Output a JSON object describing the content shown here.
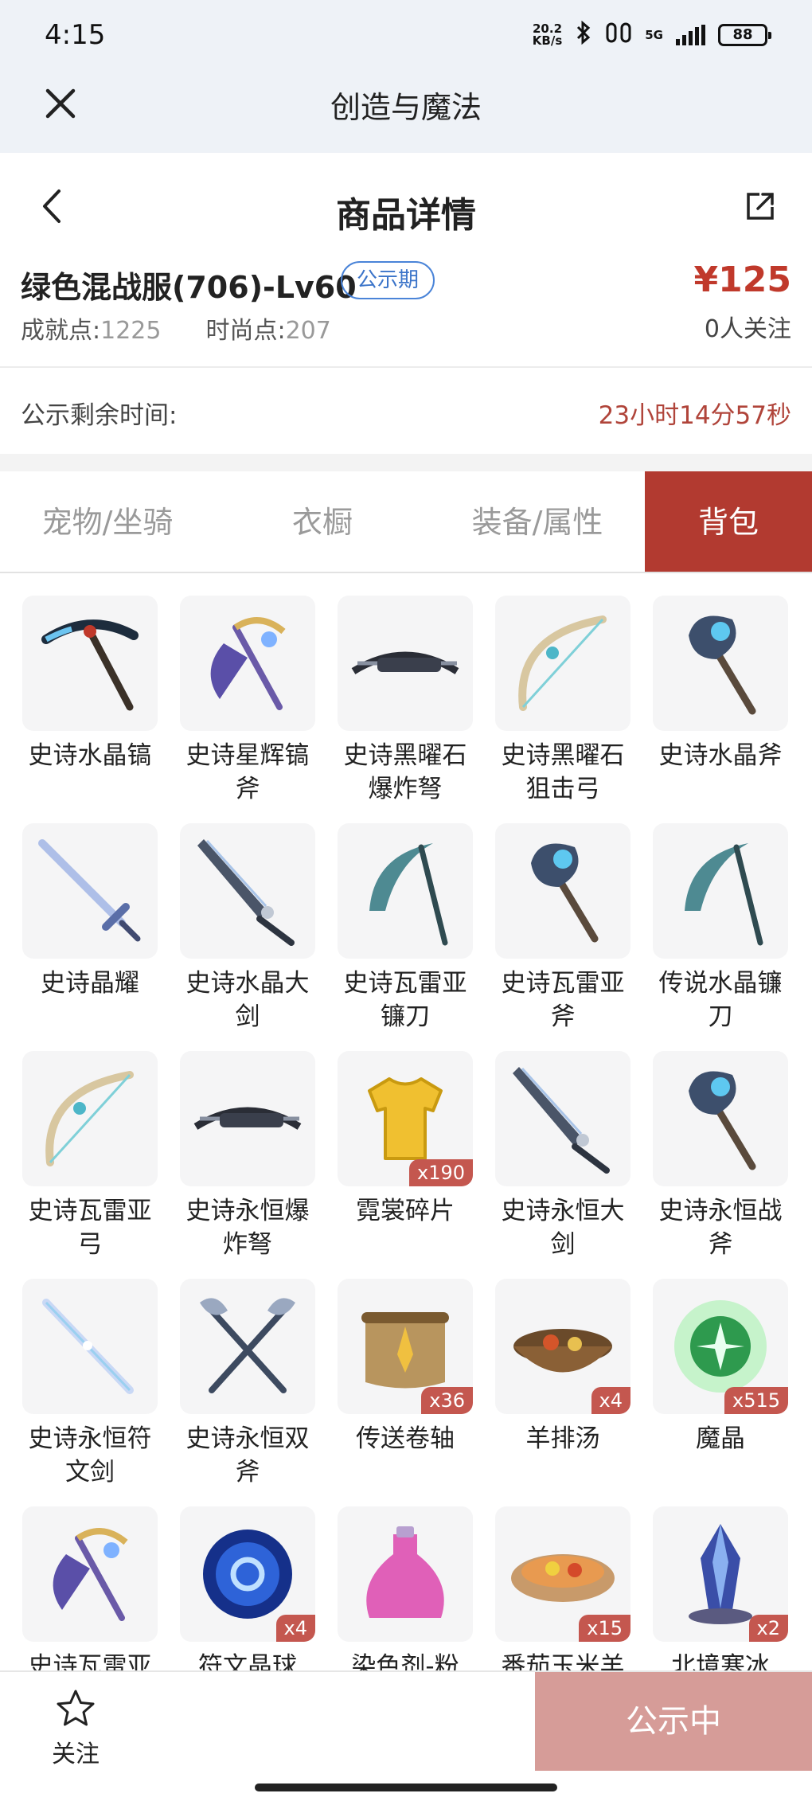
{
  "status_bar": {
    "time": "4:15",
    "net_speed_value": "20.2",
    "net_speed_unit": "KB/s",
    "network": "5G",
    "battery": "88"
  },
  "app": {
    "title": "创造与魔法"
  },
  "nav": {
    "title": "商品详情"
  },
  "item": {
    "name": "绿色混战服(706)-Lv60",
    "badge": "公示期",
    "price": "¥125",
    "follow_count": "0人关注",
    "achievement_label": "成就点:",
    "achievement_value": "1225",
    "fashion_label": "时尚点:",
    "fashion_value": "207"
  },
  "timer": {
    "label": "公示剩余时间:",
    "value": "23小时14分57秒"
  },
  "tabs": [
    {
      "label": "宠物/坐骑",
      "active": false
    },
    {
      "label": "衣橱",
      "active": false
    },
    {
      "label": "装备/属性",
      "active": false
    },
    {
      "label": "背包",
      "active": true
    }
  ],
  "inventory": [
    {
      "name": "史诗水晶镐",
      "qty": "",
      "icon": "pickaxe-icon"
    },
    {
      "name": "史诗星辉镐斧",
      "qty": "",
      "icon": "pickaxe-axe-icon"
    },
    {
      "name": "史诗黑曜石爆炸弩",
      "qty": "",
      "icon": "crossbow-icon"
    },
    {
      "name": "史诗黑曜石狙击弓",
      "qty": "",
      "icon": "bow-icon"
    },
    {
      "name": "史诗水晶斧",
      "qty": "",
      "icon": "axe-icon"
    },
    {
      "name": "史诗晶耀",
      "qty": "",
      "icon": "sword-icon"
    },
    {
      "name": "史诗水晶大剑",
      "qty": "",
      "icon": "greatsword-icon"
    },
    {
      "name": "史诗瓦雷亚镰刀",
      "qty": "",
      "icon": "scythe-icon"
    },
    {
      "name": "史诗瓦雷亚斧",
      "qty": "",
      "icon": "axe-icon"
    },
    {
      "name": "传说水晶镰刀",
      "qty": "",
      "icon": "scythe-icon"
    },
    {
      "name": "史诗瓦雷亚弓",
      "qty": "",
      "icon": "bow-icon"
    },
    {
      "name": "史诗永恒爆炸弩",
      "qty": "",
      "icon": "crossbow-icon"
    },
    {
      "name": "霓裳碎片",
      "qty": "x190",
      "icon": "shirt-icon"
    },
    {
      "name": "史诗永恒大剑",
      "qty": "",
      "icon": "greatsword-icon"
    },
    {
      "name": "史诗永恒战斧",
      "qty": "",
      "icon": "axe-icon"
    },
    {
      "name": "史诗永恒符文剑",
      "qty": "",
      "icon": "rune-sword-icon"
    },
    {
      "name": "史诗永恒双斧",
      "qty": "",
      "icon": "double-axe-icon"
    },
    {
      "name": "传送卷轴",
      "qty": "x36",
      "icon": "scroll-icon"
    },
    {
      "name": "羊排汤",
      "qty": "x4",
      "icon": "soup-icon"
    },
    {
      "name": "魔晶",
      "qty": "x515",
      "icon": "magic-crystal-icon"
    },
    {
      "name": "史诗瓦雷亚",
      "qty": "",
      "icon": "pickaxe-axe-icon"
    },
    {
      "name": "符文晶球",
      "qty": "x4",
      "icon": "rune-orb-icon"
    },
    {
      "name": "染色剂-粉",
      "qty": "",
      "icon": "dye-bottle-icon"
    },
    {
      "name": "番茄玉米羊",
      "qty": "x15",
      "icon": "stew-icon"
    },
    {
      "name": "北境寒冰",
      "qty": "x2",
      "icon": "ice-crystal-icon"
    }
  ],
  "bottom_bar": {
    "follow_label": "关注",
    "status_label": "公示中"
  },
  "colors": {
    "accent": "#b23a30",
    "price": "#c0392b",
    "badge": "#3b74c9",
    "disabled_button": "#d69c98"
  }
}
